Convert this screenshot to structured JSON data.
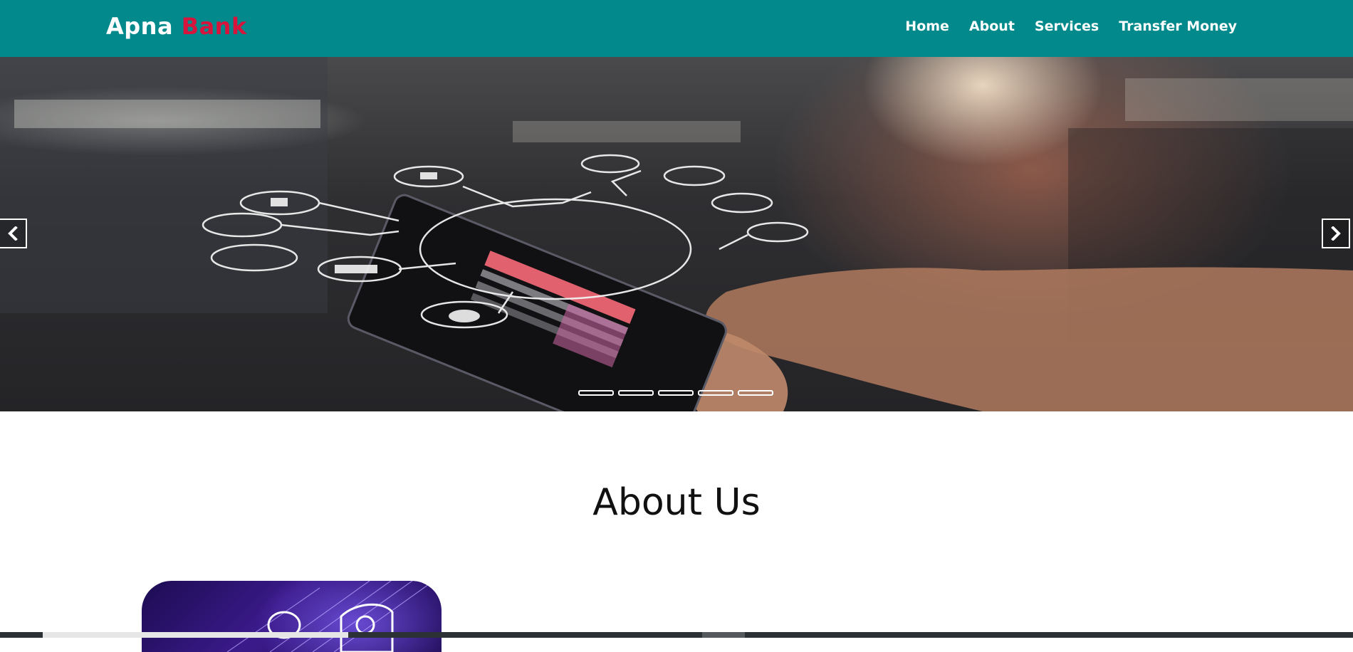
{
  "brand": {
    "part1": "Apna",
    "part2": "Bank"
  },
  "nav": {
    "items": [
      {
        "label": "Home"
      },
      {
        "label": "About"
      },
      {
        "label": "Services"
      },
      {
        "label": "Transfer Money"
      }
    ]
  },
  "hero": {
    "slide_count": 5,
    "prev_icon": "chevron-left-icon",
    "next_icon": "chevron-right-icon"
  },
  "about": {
    "title": "About Us"
  },
  "colors": {
    "navbar_bg": "#02898b",
    "brand_accent": "#d7143c",
    "text_light": "#ffffff",
    "heading": "#111111"
  }
}
